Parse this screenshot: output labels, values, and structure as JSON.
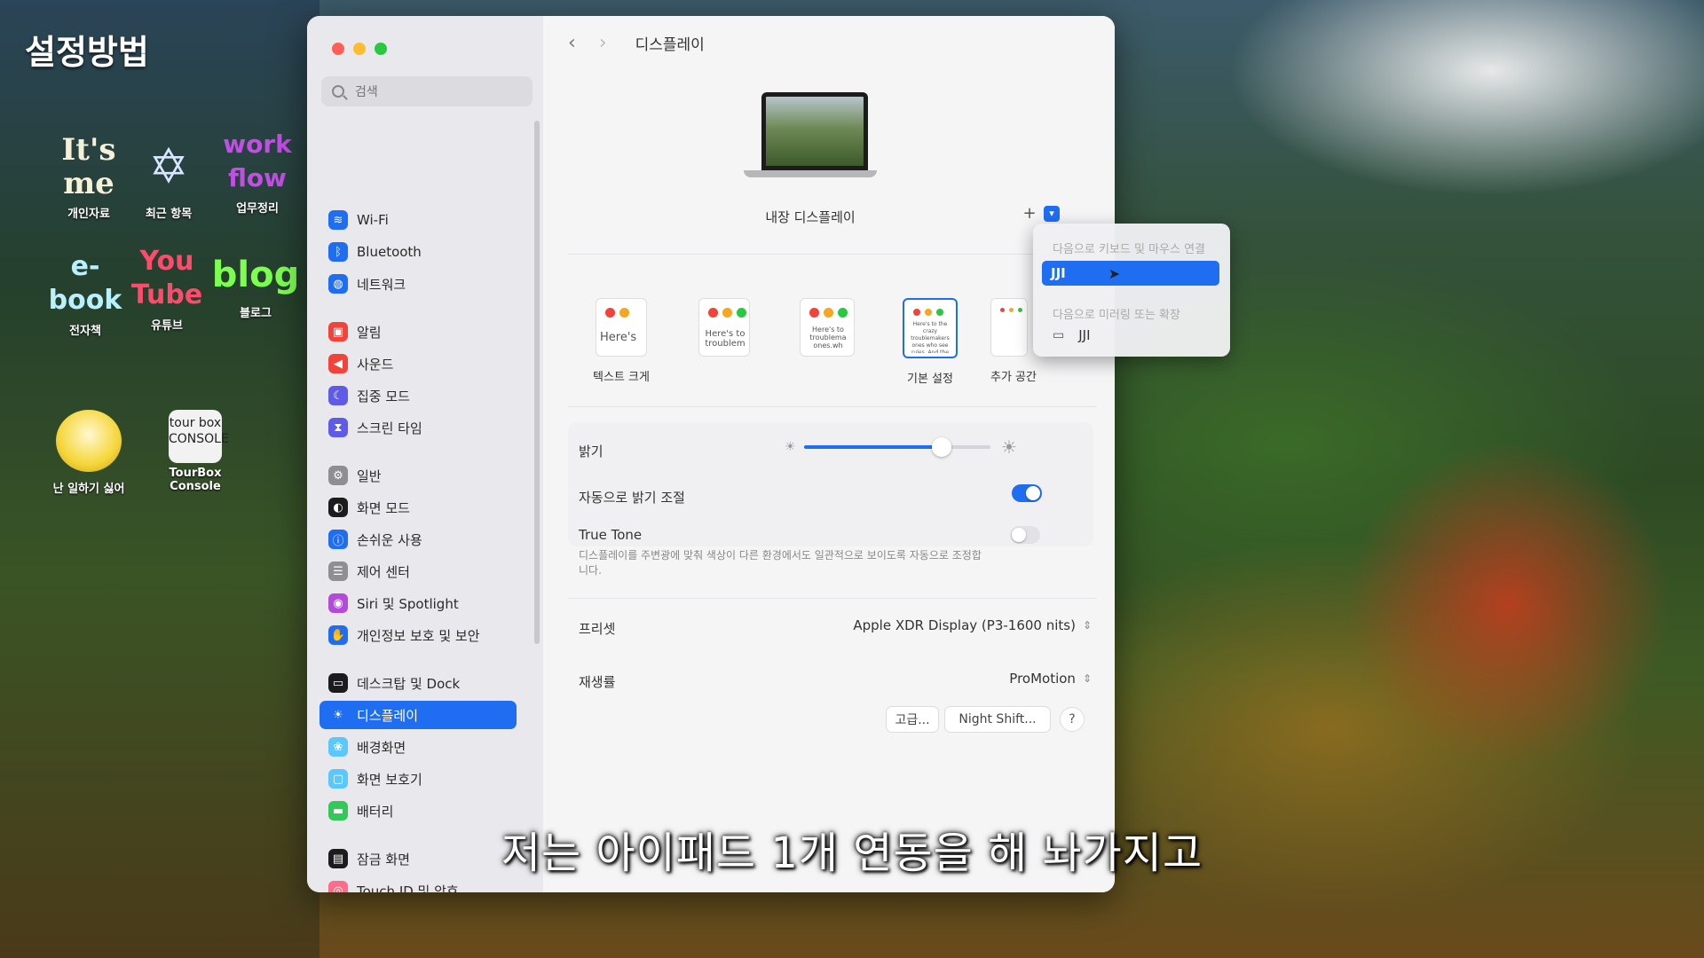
{
  "overlay": {
    "video_title": "설정방법",
    "subtitle": "저는 아이패드 1개 연동을 해 놔가지고"
  },
  "desktop_icons": [
    {
      "art": "It's me",
      "label": "개인자료",
      "color": "#f5f0d8"
    },
    {
      "art": "✡",
      "label": "최근 항목",
      "color": "#d9e6ff"
    },
    {
      "art": "work flow",
      "label": "업무정리",
      "color": "#c34ee6"
    },
    {
      "art": "e-book",
      "label": "전자책",
      "color": "#b9f0ff"
    },
    {
      "art": "You Tube",
      "label": "유튜브",
      "color": "#ff4b6b"
    },
    {
      "art": "blog",
      "label": "블로그",
      "color": "#7dff4f"
    },
    {
      "art": "",
      "label": "난 일하기 싫어",
      "color": "#f5d63a"
    },
    {
      "art": "tour box CONSOLE",
      "label": "TourBox Console",
      "color": "#222222"
    }
  ],
  "window": {
    "search_placeholder": "검색",
    "sidebar": [
      {
        "label": "Wi-Fi",
        "icon": "wifi-icon",
        "color": "#1f6ef2",
        "glyph": "≋"
      },
      {
        "label": "Bluetooth",
        "icon": "bluetooth-icon",
        "color": "#1f6ef2",
        "glyph": "ᛒ"
      },
      {
        "label": "네트워크",
        "icon": "network-icon",
        "color": "#1f6ef2",
        "glyph": "◍"
      },
      {
        "label": "알림",
        "icon": "notifications-icon",
        "color": "#f0433a",
        "glyph": "▣"
      },
      {
        "label": "사운드",
        "icon": "sound-icon",
        "color": "#f0433a",
        "glyph": "◀"
      },
      {
        "label": "집중 모드",
        "icon": "focus-icon",
        "color": "#5e5ce6",
        "glyph": "☾"
      },
      {
        "label": "스크린 타임",
        "icon": "screen-time-icon",
        "color": "#5e5ce6",
        "glyph": "⧗"
      },
      {
        "label": "일반",
        "icon": "general-icon",
        "color": "#8e8e93",
        "glyph": "⚙"
      },
      {
        "label": "화면 모드",
        "icon": "appearance-icon",
        "color": "#1c1c1e",
        "glyph": "◐"
      },
      {
        "label": "손쉬운 사용",
        "icon": "accessibility-icon",
        "color": "#1f6ef2",
        "glyph": "ⓘ"
      },
      {
        "label": "제어 센터",
        "icon": "control-center-icon",
        "color": "#8e8e93",
        "glyph": "☰"
      },
      {
        "label": "Siri 및 Spotlight",
        "icon": "siri-icon",
        "color": "#b24bd9",
        "glyph": "◉"
      },
      {
        "label": "개인정보 보호 및 보안",
        "icon": "privacy-icon",
        "color": "#1f6ef2",
        "glyph": "✋"
      },
      {
        "label": "데스크탑 및 Dock",
        "icon": "dock-icon",
        "color": "#1c1c1e",
        "glyph": "▭"
      },
      {
        "label": "디스플레이",
        "icon": "display-icon",
        "color": "#1f6ef2",
        "glyph": "☀"
      },
      {
        "label": "배경화면",
        "icon": "wallpaper-icon",
        "color": "#5ac8fa",
        "glyph": "❀"
      },
      {
        "label": "화면 보호기",
        "icon": "screensaver-icon",
        "color": "#5ac8fa",
        "glyph": "▢"
      },
      {
        "label": "배터리",
        "icon": "battery-icon",
        "color": "#34c759",
        "glyph": "▬"
      },
      {
        "label": "잠금 화면",
        "icon": "lock-screen-icon",
        "color": "#1c1c1e",
        "glyph": "▤"
      },
      {
        "label": "Touch ID 및 암호",
        "icon": "touchid-icon",
        "color": "#ff6b8a",
        "glyph": "◎"
      }
    ],
    "active_sidebar": "디스플레이",
    "nav_title": "디스플레이",
    "display_name": "내장 디스플레이",
    "resolutions": [
      {
        "label": "텍스트 크게",
        "sample": "Here's"
      },
      {
        "label": "",
        "sample": "Here's to troublem"
      },
      {
        "label": "",
        "sample": "Here's to troublema ones.wh"
      },
      {
        "label": "기본 설정",
        "sample": "Here's to the crazy troublemakers ones who see rules. And the"
      },
      {
        "label": "추가 공간",
        "sample": ""
      }
    ],
    "brightness_label": "밝기",
    "brightness_level": 0.74,
    "auto_brightness_label": "자동으로 밝기 조절",
    "auto_brightness_on": true,
    "true_tone_label": "True Tone",
    "true_tone_desc": "디스플레이를 주변광에 맞춰 색상이 다른 환경에서도 일관적으로 보이도록 자동으로 조정합니다.",
    "true_tone_on": false,
    "preset_label": "프리셋",
    "preset_value": "Apple XDR Display (P3-1600 nits)",
    "refresh_label": "재생률",
    "refresh_value": "ProMotion",
    "advanced_button": "고급...",
    "night_shift_button": "Night Shift...",
    "help_button": "?"
  },
  "menu": {
    "header_keyboard": "다음으로 키보드 및 마우스 연결",
    "option_keyboard": "JJI",
    "header_mirror": "다음으로 미러링 또는 확장",
    "option_mirror": "JJI"
  }
}
